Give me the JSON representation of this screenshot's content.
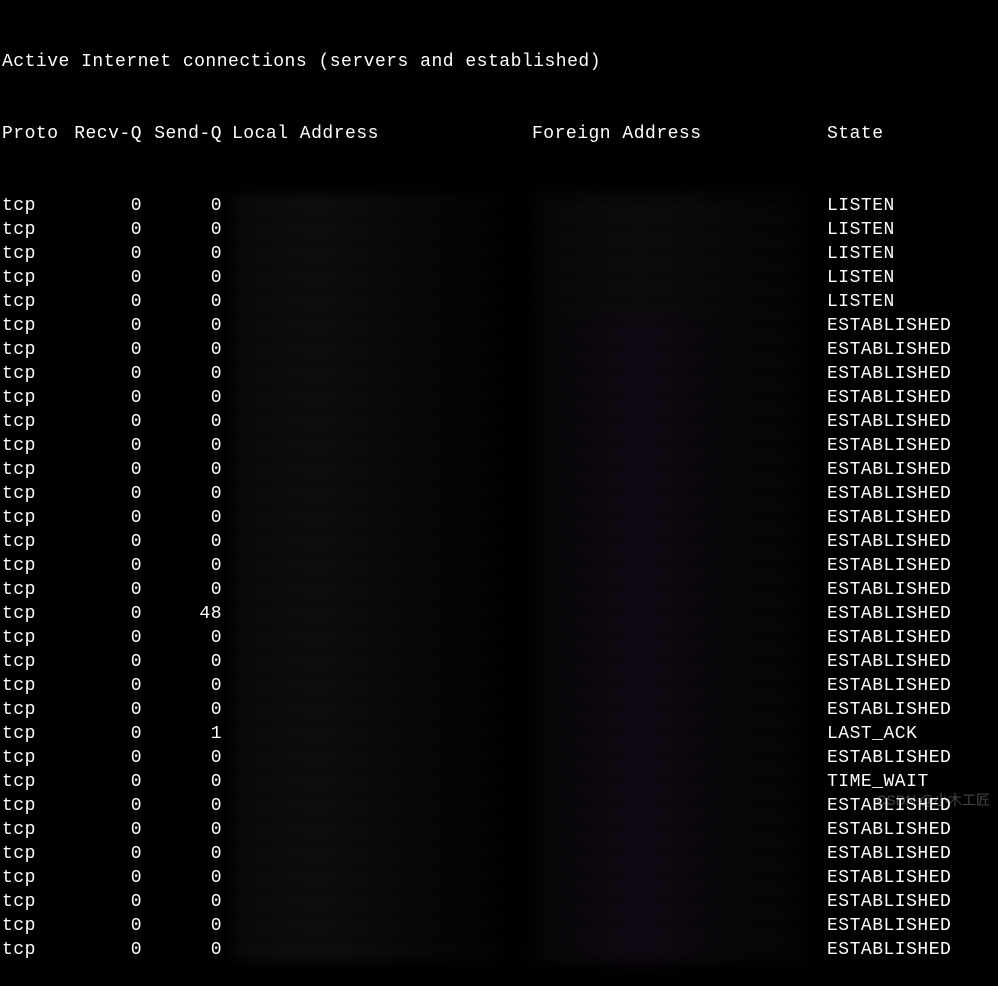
{
  "title": "Active Internet connections (servers and established)",
  "headers": {
    "proto": "Proto",
    "recvq": "Recv-Q",
    "sendq": "Send-Q",
    "local": "Local Address",
    "foreign": "Foreign Address",
    "state": "State"
  },
  "rows": [
    {
      "proto": "tcp",
      "recvq": "0",
      "sendq": "0",
      "state": "LISTEN"
    },
    {
      "proto": "tcp",
      "recvq": "0",
      "sendq": "0",
      "state": "LISTEN"
    },
    {
      "proto": "tcp",
      "recvq": "0",
      "sendq": "0",
      "state": "LISTEN"
    },
    {
      "proto": "tcp",
      "recvq": "0",
      "sendq": "0",
      "state": "LISTEN"
    },
    {
      "proto": "tcp",
      "recvq": "0",
      "sendq": "0",
      "state": "LISTEN"
    },
    {
      "proto": "tcp",
      "recvq": "0",
      "sendq": "0",
      "state": "ESTABLISHED"
    },
    {
      "proto": "tcp",
      "recvq": "0",
      "sendq": "0",
      "state": "ESTABLISHED"
    },
    {
      "proto": "tcp",
      "recvq": "0",
      "sendq": "0",
      "state": "ESTABLISHED"
    },
    {
      "proto": "tcp",
      "recvq": "0",
      "sendq": "0",
      "state": "ESTABLISHED"
    },
    {
      "proto": "tcp",
      "recvq": "0",
      "sendq": "0",
      "state": "ESTABLISHED"
    },
    {
      "proto": "tcp",
      "recvq": "0",
      "sendq": "0",
      "state": "ESTABLISHED"
    },
    {
      "proto": "tcp",
      "recvq": "0",
      "sendq": "0",
      "state": "ESTABLISHED"
    },
    {
      "proto": "tcp",
      "recvq": "0",
      "sendq": "0",
      "state": "ESTABLISHED"
    },
    {
      "proto": "tcp",
      "recvq": "0",
      "sendq": "0",
      "state": "ESTABLISHED"
    },
    {
      "proto": "tcp",
      "recvq": "0",
      "sendq": "0",
      "state": "ESTABLISHED"
    },
    {
      "proto": "tcp",
      "recvq": "0",
      "sendq": "0",
      "state": "ESTABLISHED"
    },
    {
      "proto": "tcp",
      "recvq": "0",
      "sendq": "0",
      "state": "ESTABLISHED"
    },
    {
      "proto": "tcp",
      "recvq": "0",
      "sendq": "48",
      "state": "ESTABLISHED"
    },
    {
      "proto": "tcp",
      "recvq": "0",
      "sendq": "0",
      "state": "ESTABLISHED"
    },
    {
      "proto": "tcp",
      "recvq": "0",
      "sendq": "0",
      "state": "ESTABLISHED"
    },
    {
      "proto": "tcp",
      "recvq": "0",
      "sendq": "0",
      "state": "ESTABLISHED"
    },
    {
      "proto": "tcp",
      "recvq": "0",
      "sendq": "0",
      "state": "ESTABLISHED"
    },
    {
      "proto": "tcp",
      "recvq": "0",
      "sendq": "1",
      "state": "LAST_ACK"
    },
    {
      "proto": "tcp",
      "recvq": "0",
      "sendq": "0",
      "state": "ESTABLISHED"
    },
    {
      "proto": "tcp",
      "recvq": "0",
      "sendq": "0",
      "state": "TIME_WAIT"
    },
    {
      "proto": "tcp",
      "recvq": "0",
      "sendq": "0",
      "state": "ESTABLISHED"
    },
    {
      "proto": "tcp",
      "recvq": "0",
      "sendq": "0",
      "state": "ESTABLISHED"
    },
    {
      "proto": "tcp",
      "recvq": "0",
      "sendq": "0",
      "state": "ESTABLISHED"
    },
    {
      "proto": "tcp",
      "recvq": "0",
      "sendq": "0",
      "state": "ESTABLISHED"
    },
    {
      "proto": "tcp",
      "recvq": "0",
      "sendq": "0",
      "state": "ESTABLISHED"
    },
    {
      "proto": "tcp",
      "recvq": "0",
      "sendq": "0",
      "state": "ESTABLISHED"
    },
    {
      "proto": "tcp",
      "recvq": "0",
      "sendq": "0",
      "state": "ESTABLISHED"
    }
  ],
  "watermark": "CSDN @小木工匠"
}
